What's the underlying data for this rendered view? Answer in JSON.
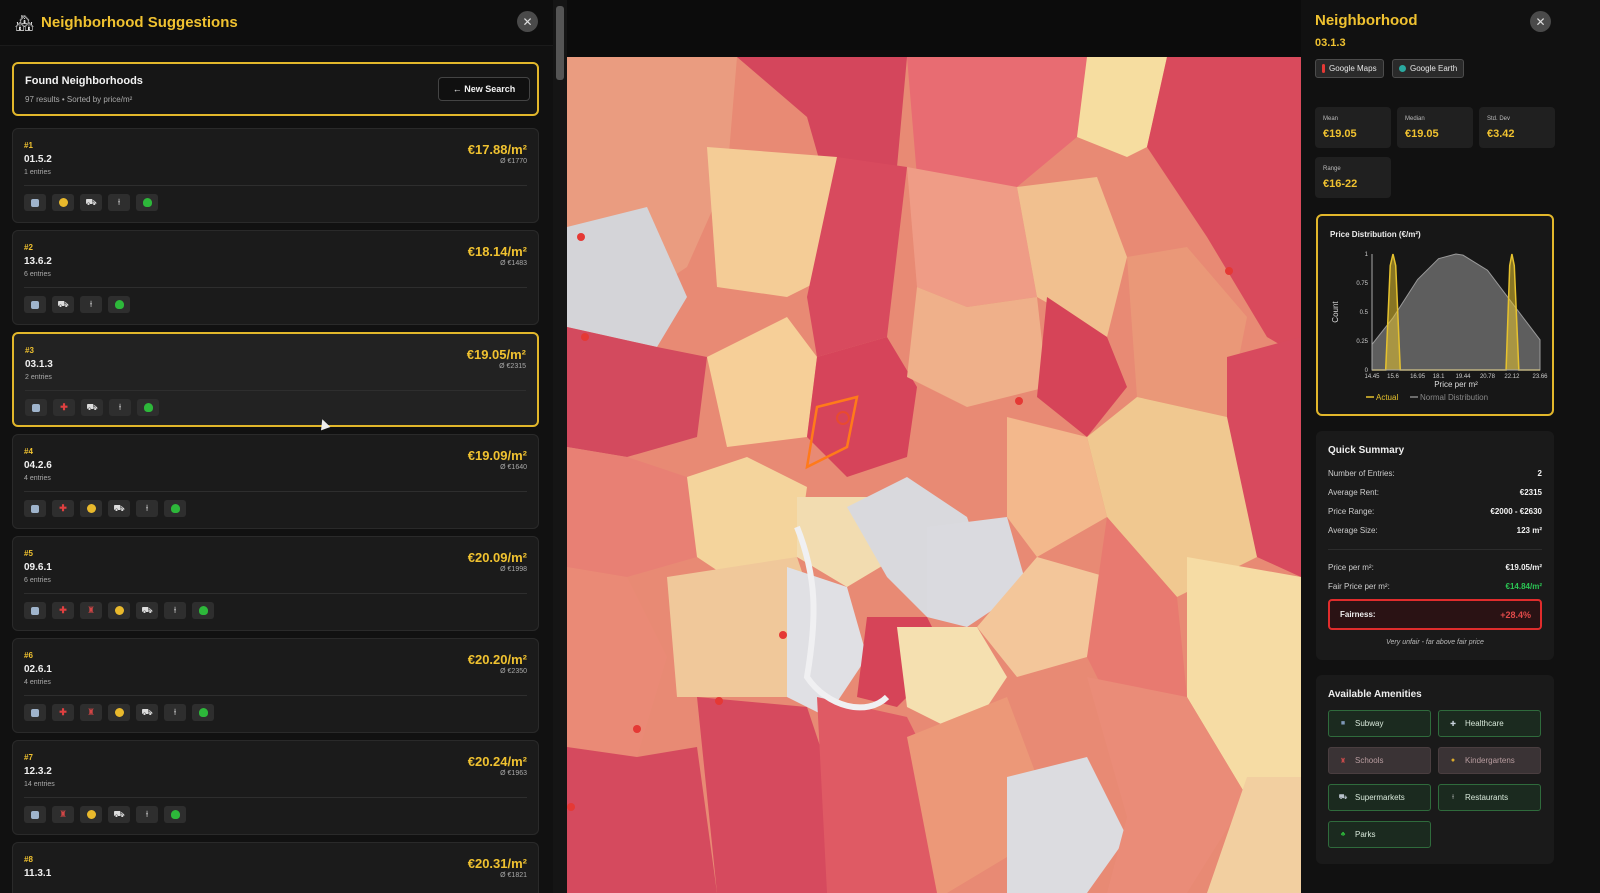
{
  "left": {
    "title": "Neighborhood Suggestions",
    "close_label": "✕",
    "found_title": "Found Neighborhoods",
    "found_sub": "97 results • Sorted by price/m²",
    "new_search_label": "← New Search"
  },
  "cards": [
    {
      "rank": "#1",
      "code": "01.5.2",
      "entries": "1 entries",
      "price": "€17.88/m²",
      "avg": "Ø €1770",
      "icons": [
        "subway-icon",
        "kindergarten-icon",
        "supermarket-icon",
        "restaurant-icon",
        "park-icon"
      ]
    },
    {
      "rank": "#2",
      "code": "13.6.2",
      "entries": "6 entries",
      "price": "€18.14/m²",
      "avg": "Ø €1483",
      "icons": [
        "subway-icon",
        "supermarket-icon",
        "restaurant-icon",
        "park-icon"
      ]
    },
    {
      "rank": "#3",
      "code": "03.1.3",
      "entries": "2 entries",
      "price": "€19.05/m²",
      "avg": "Ø €2315",
      "icons": [
        "subway-icon",
        "healthcare-icon",
        "supermarket-icon",
        "restaurant-icon",
        "park-icon"
      ]
    },
    {
      "rank": "#4",
      "code": "04.2.6",
      "entries": "4 entries",
      "price": "€19.09/m²",
      "avg": "Ø €1640",
      "icons": [
        "subway-icon",
        "healthcare-icon",
        "kindergarten-icon",
        "supermarket-icon",
        "restaurant-icon",
        "park-icon"
      ]
    },
    {
      "rank": "#5",
      "code": "09.6.1",
      "entries": "6 entries",
      "price": "€20.09/m²",
      "avg": "Ø €1998",
      "icons": [
        "subway-icon",
        "healthcare-icon",
        "school-icon",
        "kindergarten-icon",
        "supermarket-icon",
        "restaurant-icon",
        "park-icon"
      ]
    },
    {
      "rank": "#6",
      "code": "02.6.1",
      "entries": "4 entries",
      "price": "€20.20/m²",
      "avg": "Ø €2350",
      "icons": [
        "subway-icon",
        "healthcare-icon",
        "school-icon",
        "kindergarten-icon",
        "supermarket-icon",
        "restaurant-icon",
        "park-icon"
      ]
    },
    {
      "rank": "#7",
      "code": "12.3.2",
      "entries": "14 entries",
      "price": "€20.24/m²",
      "avg": "Ø €1963",
      "icons": [
        "subway-icon",
        "school-icon",
        "kindergarten-icon",
        "supermarket-icon",
        "restaurant-icon",
        "park-icon"
      ]
    },
    {
      "rank": "#8",
      "code": "11.3.1",
      "entries": "",
      "price": "€20.31/m²",
      "avg": "Ø €1821",
      "icons": []
    }
  ],
  "right": {
    "title": "Neighborhood",
    "code": "03.1.3",
    "close_label": "✕",
    "google_maps": "Google Maps",
    "google_earth": "Google Earth",
    "stats": [
      {
        "label": "Mean",
        "value": "€19.05"
      },
      {
        "label": "Median",
        "value": "€19.05"
      },
      {
        "label": "Std. Dev",
        "value": "€3.42"
      },
      {
        "label": "Range",
        "value": "€16-22"
      }
    ],
    "summary": {
      "title": "Quick Summary",
      "rows": [
        {
          "label": "Number of Entries:",
          "value": "2"
        },
        {
          "label": "Average Rent:",
          "value": "€2315"
        },
        {
          "label": "Price Range:",
          "value": "€2000 - €2630"
        },
        {
          "label": "Average Size:",
          "value": "123 m²"
        }
      ],
      "price_label": "Price per m²:",
      "price_value": "€19.05/m²",
      "fair_label": "Fair Price per m²:",
      "fair_value": "€14.84/m²",
      "fairness_label": "Fairness:",
      "fairness_value": "+28.4%",
      "fairness_note": "Very unfair - far above fair price"
    },
    "amenities": {
      "title": "Available Amenities",
      "items": [
        {
          "label": "Subway",
          "on": true,
          "icon": "subway-icon",
          "color": "#7f98b8"
        },
        {
          "label": "Healthcare",
          "on": true,
          "icon": "healthcare-icon",
          "color": "#c9d2dc"
        },
        {
          "label": "Schools",
          "on": false,
          "icon": "school-icon",
          "color": "#c44a4a"
        },
        {
          "label": "Kindergartens",
          "on": false,
          "icon": "kindergarten-icon",
          "color": "#d9a92a"
        },
        {
          "label": "Supermarkets",
          "on": true,
          "icon": "supermarket-icon",
          "color": "#b9c2cc"
        },
        {
          "label": "Restaurants",
          "on": true,
          "icon": "restaurant-icon",
          "color": "#dddddd"
        },
        {
          "label": "Parks",
          "on": true,
          "icon": "park-icon",
          "color": "#2db83a"
        }
      ]
    }
  },
  "chart_data": {
    "type": "line",
    "title": "Price Distribution (€/m²)",
    "xlabel": "Price per m²",
    "ylabel": "Count",
    "xticks": [
      "14.45",
      "15.6",
      "16.95",
      "18.1",
      "19.44",
      "20.78",
      "22.12",
      "23.66"
    ],
    "yticks": [
      "0",
      "0.25",
      "0.5",
      "0.75",
      "1"
    ],
    "xlim": [
      14.45,
      23.66
    ],
    "ylim": [
      0,
      1
    ],
    "series": [
      {
        "name": "Actual",
        "color": "#e6c22e",
        "x": [
          14.45,
          15.2,
          15.45,
          15.6,
          15.75,
          16.0,
          16.95,
          18.1,
          19.44,
          20.78,
          21.8,
          22.0,
          22.12,
          22.25,
          22.5,
          23.66
        ],
        "y": [
          0,
          0,
          0.9,
          1.0,
          0.9,
          0,
          0,
          0,
          0,
          0,
          0,
          0.9,
          1.0,
          0.9,
          0,
          0
        ]
      },
      {
        "name": "Normal Distribution",
        "color": "#8a8a8a",
        "x": [
          14.45,
          15.6,
          16.95,
          18.1,
          19.05,
          19.44,
          20.78,
          22.12,
          23.66
        ],
        "y": [
          0.22,
          0.45,
          0.78,
          0.96,
          1.0,
          0.99,
          0.86,
          0.58,
          0.26
        ]
      }
    ],
    "legend": [
      "Actual",
      "Normal Distribution"
    ],
    "legend_position": "bottom"
  }
}
